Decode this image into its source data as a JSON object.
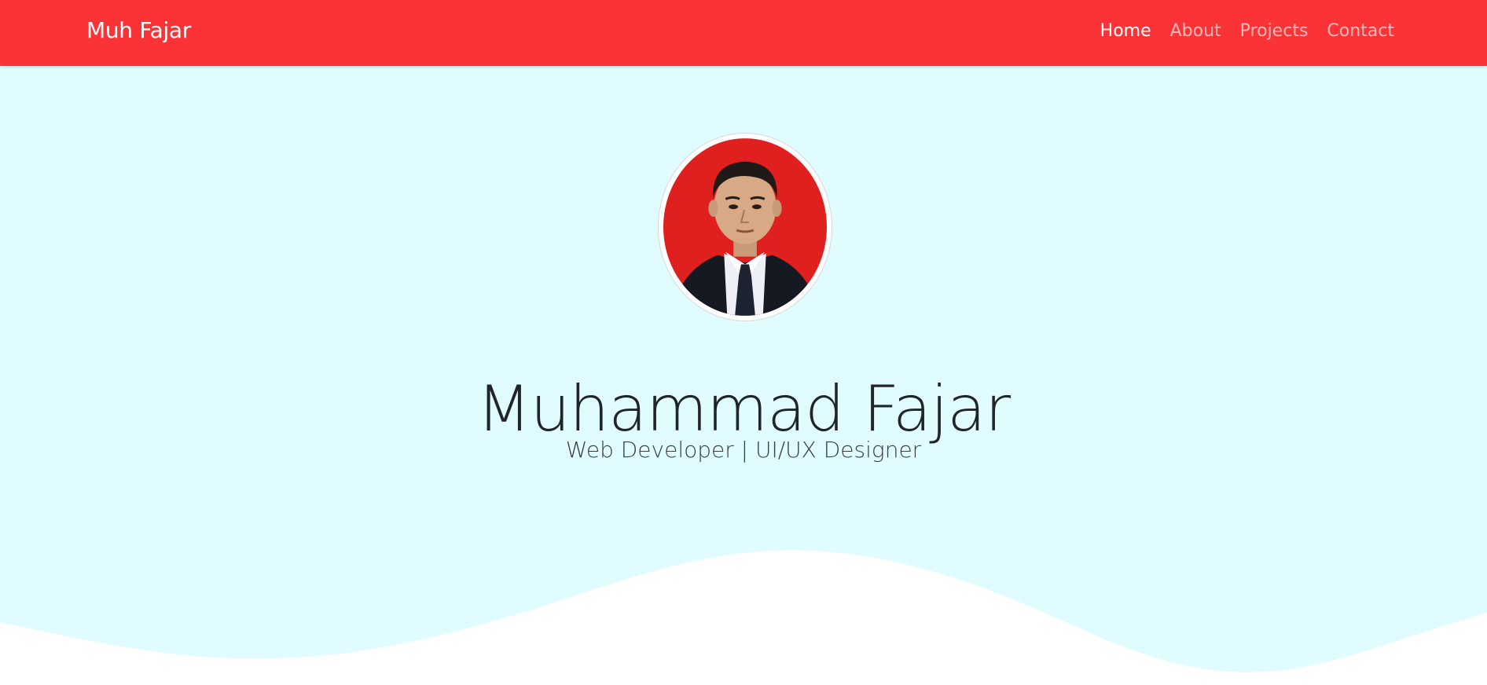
{
  "navbar": {
    "brand": "Muh Fajar",
    "links": [
      {
        "label": "Home",
        "active": true
      },
      {
        "label": "About",
        "active": false
      },
      {
        "label": "Projects",
        "active": false
      },
      {
        "label": "Contact",
        "active": false
      }
    ]
  },
  "hero": {
    "name": "Muhammad Fajar",
    "subtitle": "Web Developer | UI/UX Designer",
    "avatar_icon": "profile-photo"
  },
  "colors": {
    "navbar_bg": "#fc3336",
    "hero_bg": "#e0fcff",
    "wave": "#ffffff",
    "avatar_bg": "#e01f1f"
  }
}
